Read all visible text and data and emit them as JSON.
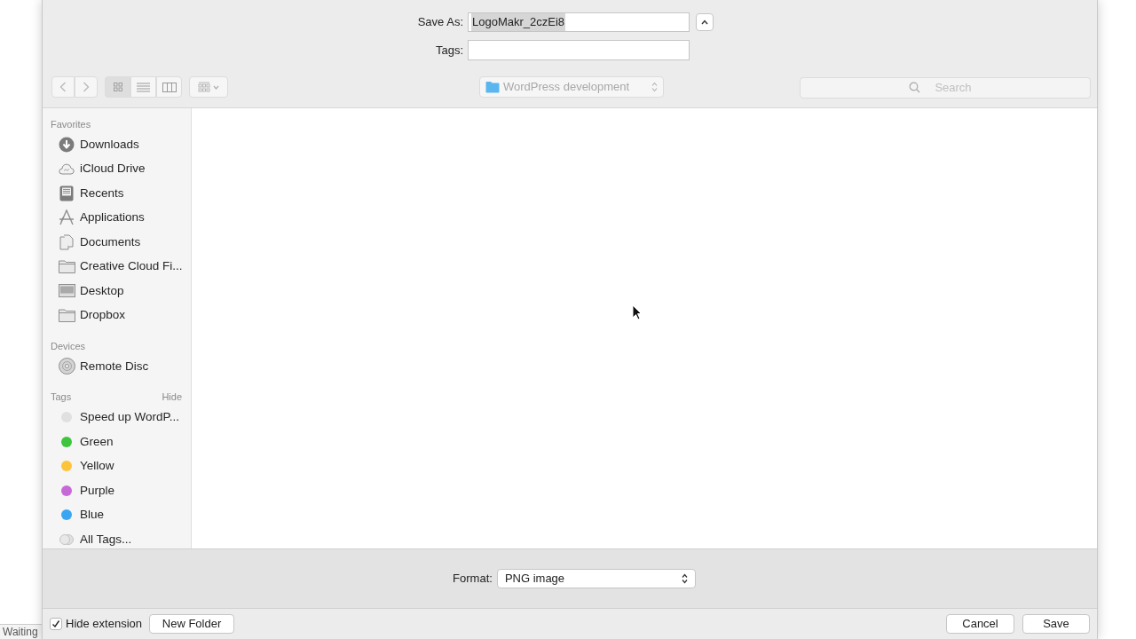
{
  "background_status": "Waiting",
  "save_as": {
    "label": "Save As:",
    "value": "LogoMakr_2czEi8",
    "text_selected": true
  },
  "tags_field": {
    "label": "Tags:"
  },
  "view_modes": [
    {
      "kind": "icons",
      "selected": true
    },
    {
      "kind": "list",
      "selected": false
    },
    {
      "kind": "columns",
      "selected": false
    }
  ],
  "location": "WordPress development",
  "search": {
    "placeholder": "Search"
  },
  "sidebar": [
    {
      "title": "Favorites",
      "items": [
        {
          "kind": "downloads",
          "label": "Downloads"
        },
        {
          "kind": "cloud",
          "label": "iCloud Drive"
        },
        {
          "kind": "recents",
          "label": "Recents"
        },
        {
          "kind": "apps",
          "label": "Applications"
        },
        {
          "kind": "document",
          "label": "Documents"
        },
        {
          "kind": "folder",
          "label": "Creative Cloud Fi..."
        },
        {
          "kind": "desktop",
          "label": "Desktop"
        },
        {
          "kind": "folder",
          "label": "Dropbox"
        }
      ]
    },
    {
      "title": "Devices",
      "items": [
        {
          "kind": "disc",
          "label": "Remote Disc"
        }
      ]
    },
    {
      "title": "Tags",
      "action": "Hide",
      "items": [
        {
          "kind": "tag",
          "label": "Speed up WordP...",
          "color": "#e0e0e0"
        },
        {
          "kind": "tag",
          "label": "Green",
          "color": "#3fc43f"
        },
        {
          "kind": "tag",
          "label": "Yellow",
          "color": "#fcc43a"
        },
        {
          "kind": "tag",
          "label": "Purple",
          "color": "#c56ad6"
        },
        {
          "kind": "tag",
          "label": "Blue",
          "color": "#3aa6f3"
        },
        {
          "kind": "alltags",
          "label": "All Tags..."
        }
      ]
    }
  ],
  "format": {
    "label": "Format:",
    "value": "PNG image"
  },
  "hide_extension": {
    "label": "Hide extension",
    "checked": true
  },
  "buttons": [
    {
      "kind": "secondary",
      "label": "New Folder"
    },
    {
      "kind": "secondary",
      "label": "Cancel"
    },
    {
      "kind": "primary",
      "label": "Save"
    }
  ]
}
